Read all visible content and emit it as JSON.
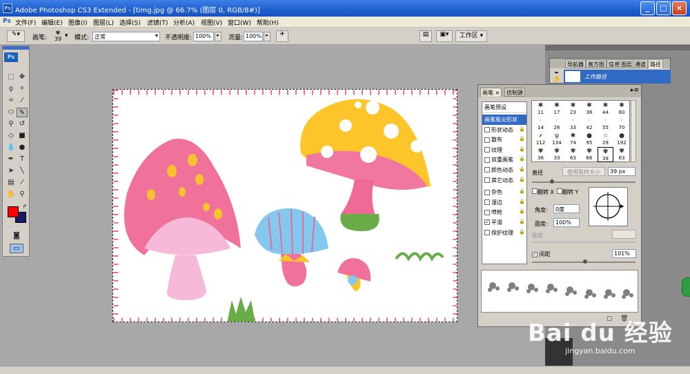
{
  "window": {
    "title": "Adobe Photoshop CS3 Extended - [timg.jpg @ 66.7% (图层 0, RGB/8#)]",
    "app_icon": "Ps"
  },
  "menu": [
    "文件(F)",
    "编辑(E)",
    "图像(I)",
    "图层(L)",
    "选择(S)",
    "滤镜(T)",
    "分析(A)",
    "视图(V)",
    "窗口(W)",
    "帮助(H)"
  ],
  "options": {
    "brush_label": "画笔:",
    "brush_size": "39",
    "mode_label": "模式:",
    "mode_value": "正常",
    "opacity_label": "不透明度:",
    "opacity_value": "100%",
    "flow_label": "流量:",
    "flow_value": "100%",
    "workspace_label": "工作区 ▾"
  },
  "toolbox": {
    "logo": "Ps",
    "foreground_color": "#ff0000",
    "background_color": "#1a1a66"
  },
  "top_panel": {
    "tabs": [
      "导航器",
      "直方图",
      "信息",
      "图层",
      "通道",
      "路径"
    ],
    "active_tab": 5,
    "path_item": "工作路径"
  },
  "brush_panel": {
    "tabs": [
      "画笔",
      "仿制源"
    ],
    "presets_header": "画笔预设",
    "items": [
      {
        "label": "画笔笔尖形状",
        "checkbox": false,
        "lock": false,
        "selected": true
      },
      {
        "label": "形状动态",
        "checkbox": true,
        "checked": false,
        "lock": true
      },
      {
        "label": "散布",
        "checkbox": true,
        "checked": false,
        "lock": true
      },
      {
        "label": "纹理",
        "checkbox": true,
        "checked": false,
        "lock": true
      },
      {
        "label": "双重画笔",
        "checkbox": true,
        "checked": false,
        "lock": true
      },
      {
        "label": "颜色动态",
        "checkbox": true,
        "checked": false,
        "lock": true
      },
      {
        "label": "其它动态",
        "checkbox": true,
        "checked": false,
        "lock": true
      },
      {
        "label": "杂色",
        "checkbox": true,
        "checked": false,
        "lock": true
      },
      {
        "label": "湿边",
        "checkbox": true,
        "checked": false,
        "lock": true
      },
      {
        "label": "喷枪",
        "checkbox": true,
        "checked": false,
        "lock": true
      },
      {
        "label": "平滑",
        "checkbox": true,
        "checked": true,
        "lock": true
      },
      {
        "label": "保护纹理",
        "checkbox": true,
        "checked": false,
        "lock": true
      }
    ],
    "tip_sizes": [
      "11",
      "17",
      "23",
      "36",
      "44",
      "60",
      "14",
      "26",
      "33",
      "42",
      "55",
      "70",
      "112",
      "134",
      "74",
      "95",
      "29",
      "192",
      "36",
      "33",
      "63",
      "66",
      "39",
      "63"
    ],
    "tip_glyphs": [
      "✱",
      "✱",
      "✱",
      "✱",
      "✱",
      "✱",
      "·",
      "·",
      "·",
      "·",
      "·",
      "·",
      "⸙",
      "ψ",
      "✱",
      "●",
      "☆",
      "●",
      "✾",
      "✾",
      "✾",
      "✾",
      "✾",
      "✾"
    ],
    "selected_tip": 22,
    "diameter_label": "直径",
    "sample_size_button": "使用取样大小",
    "diameter_value": "39 px",
    "flip_x": "翻转 X",
    "flip_y": "翻转 Y",
    "angle_label": "角度:",
    "angle_value": "0度",
    "roundness_label": "圆度:",
    "roundness_value": "100%",
    "hardness_label": "硬度",
    "spacing_label": "间距",
    "spacing_checked": true,
    "spacing_value": "101%"
  },
  "watermark": {
    "logo": "Bai du 经验",
    "url": "jingyan.baidu.com"
  }
}
